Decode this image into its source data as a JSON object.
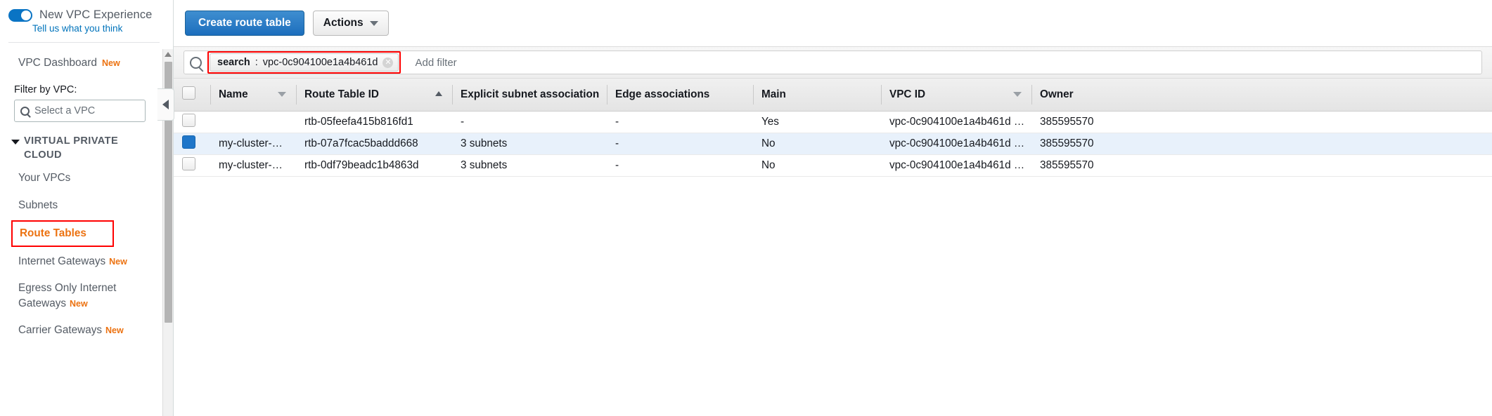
{
  "sidebar": {
    "new_experience": {
      "label": "New VPC Experience",
      "feedback_link": "Tell us what you think",
      "toggle_on": true,
      "toggle_color": "#0a74c4"
    },
    "dashboard": {
      "label": "VPC Dashboard",
      "badge": "New"
    },
    "filter": {
      "label": "Filter by VPC:",
      "placeholder": "Select a VPC",
      "value": ""
    },
    "section": {
      "title": "VIRTUAL PRIVATE CLOUD",
      "expanded": true
    },
    "items": [
      {
        "label": "Your VPCs",
        "badge": "",
        "selected": false
      },
      {
        "label": "Subnets",
        "badge": "",
        "selected": false
      },
      {
        "label": "Route Tables",
        "badge": "",
        "selected": true
      },
      {
        "label": "Internet Gateways",
        "badge": "New",
        "selected": false
      },
      {
        "label": "Egress Only Internet Gateways",
        "badge": "New",
        "selected": false
      },
      {
        "label": "Carrier Gateways",
        "badge": "New",
        "selected": false
      }
    ],
    "selected_highlight_color": "#ff0000",
    "selected_text_color": "#ec7211"
  },
  "toolbar": {
    "create_label": "Create route table",
    "actions_label": "Actions"
  },
  "search": {
    "token_key": "search",
    "token_separator": ":",
    "token_value": "vpc-0c904100e1a4b461d",
    "clear_glyph": "✕",
    "placeholder": "Add filter",
    "highlight_color": "#ff0000"
  },
  "table": {
    "select_all_checked": false,
    "columns": [
      {
        "label": "Name",
        "sort": "none",
        "caret": true
      },
      {
        "label": "Route Table ID",
        "sort": "asc",
        "caret": false
      },
      {
        "label": "Explicit subnet association",
        "sort": "none",
        "caret": false
      },
      {
        "label": "Edge associations",
        "sort": "none",
        "caret": false
      },
      {
        "label": "Main",
        "sort": "none",
        "caret": false
      },
      {
        "label": "VPC ID",
        "sort": "none",
        "caret": true
      },
      {
        "label": "Owner",
        "sort": "none",
        "caret": false
      }
    ],
    "rows": [
      {
        "checked": false,
        "name": "",
        "route_table_id": "rtb-05feefa415b816fd1",
        "explicit_subnet_association": "-",
        "edge_associations": "-",
        "main": "Yes",
        "vpc_id": "vpc-0c904100e1a4b461d …",
        "owner": "385595570"
      },
      {
        "checked": true,
        "name": "my-cluster-…",
        "route_table_id": "rtb-07a7fcac5baddd668",
        "explicit_subnet_association": "3 subnets",
        "edge_associations": "-",
        "main": "No",
        "vpc_id": "vpc-0c904100e1a4b461d …",
        "owner": "385595570"
      },
      {
        "checked": false,
        "name": "my-cluster-…",
        "route_table_id": "rtb-0df79beadc1b4863d",
        "explicit_subnet_association": "3 subnets",
        "edge_associations": "-",
        "main": "No",
        "vpc_id": "vpc-0c904100e1a4b461d …",
        "owner": "385595570"
      }
    ]
  }
}
